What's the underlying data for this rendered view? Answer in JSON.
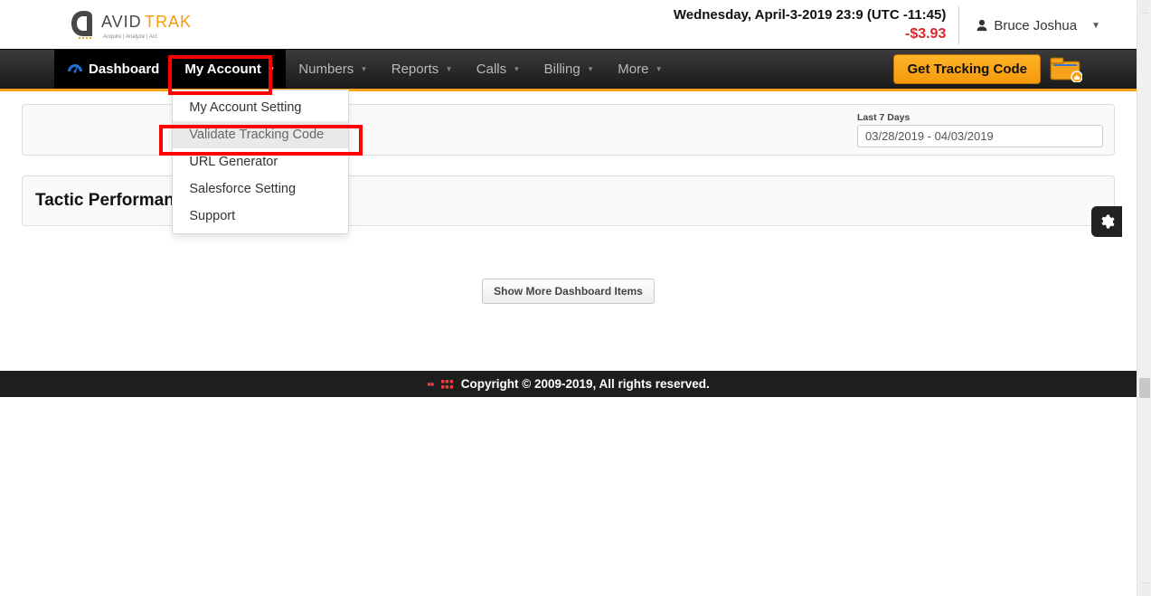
{
  "header": {
    "logo_brand_a": "AVID",
    "logo_brand_b": "TRAK",
    "logo_tag": "Acquire   |   Analyze   |   Act",
    "datetime": "Wednesday, April-3-2019 23:9 (UTC -11:45)",
    "balance": "-$3.93",
    "user_name": "Bruce Joshua"
  },
  "nav": {
    "dashboard": "Dashboard",
    "my_account": "My Account",
    "numbers": "Numbers",
    "reports": "Reports",
    "calls": "Calls",
    "billing": "Billing",
    "more": "More",
    "get_tracking": "Get Tracking Code"
  },
  "my_account_menu": {
    "items": [
      {
        "label": "My Account Setting"
      },
      {
        "label": "Validate Tracking Code"
      },
      {
        "label": "URL Generator"
      },
      {
        "label": "Salesforce Setting"
      },
      {
        "label": "Support"
      }
    ]
  },
  "filter": {
    "label": "Last 7 Days",
    "range": "03/28/2019 - 04/03/2019"
  },
  "panel": {
    "title": "Tactic Performance"
  },
  "buttons": {
    "show_more": "Show More Dashboard Items"
  },
  "footer": {
    "text": "Copyright © 2009-2019, All rights reserved."
  }
}
